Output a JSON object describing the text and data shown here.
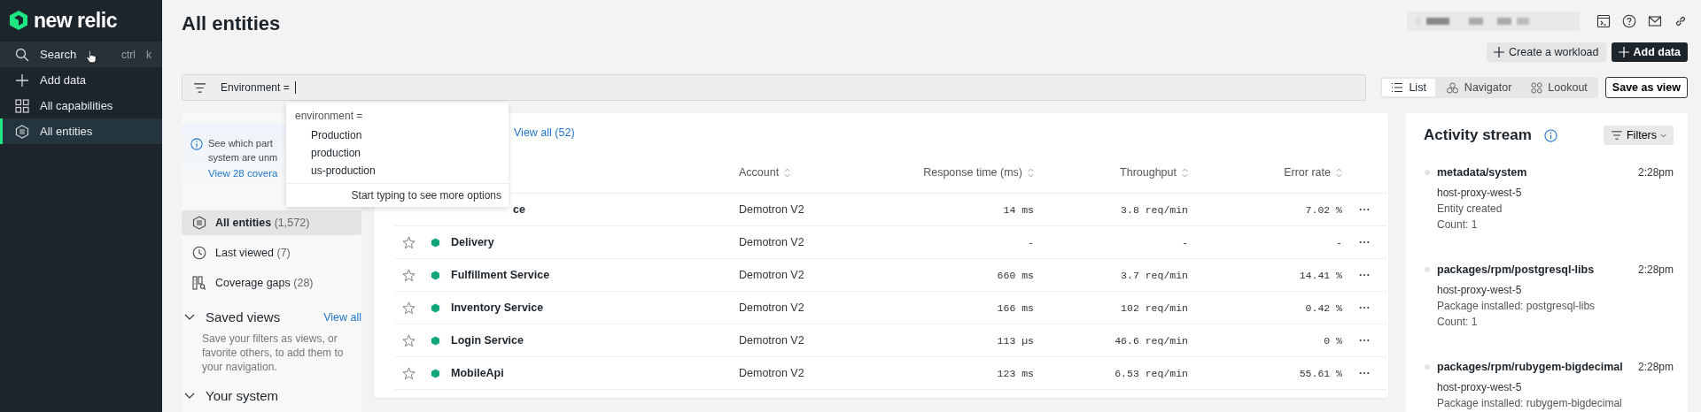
{
  "sidebar": {
    "logo": "new relic",
    "items": [
      {
        "label": "Search",
        "shortcut": [
          "ctrl",
          "k"
        ],
        "selected": false,
        "hovered": true
      },
      {
        "label": "Add data",
        "selected": false,
        "hovered": false
      },
      {
        "label": "All capabilities",
        "selected": false,
        "hovered": false
      },
      {
        "label": "All entities",
        "selected": true,
        "hovered": false
      }
    ]
  },
  "header": {
    "title": "All entities",
    "actions": [
      {
        "label": "Create a workload",
        "kind": "secondary"
      },
      {
        "label": "Add data",
        "kind": "primary"
      }
    ]
  },
  "filter": {
    "value": "Environment = "
  },
  "dropdown": {
    "heading": "environment =",
    "options": [
      "Production",
      "production",
      "us-production"
    ],
    "footer": "Start typing to see more options"
  },
  "views": {
    "tabs": [
      {
        "label": "List",
        "selected": true
      },
      {
        "label": "Navigator",
        "selected": false
      },
      {
        "label": "Lookout",
        "selected": false
      }
    ],
    "save": "Save as view"
  },
  "left_panel": {
    "notice": {
      "lines": [
        "See which part",
        "system are unm"
      ],
      "link": "View 28 covera"
    },
    "nav": [
      {
        "label": "All entities",
        "count": "(1,572)",
        "selected": true
      },
      {
        "label": "Last viewed",
        "count": "(7)",
        "selected": false
      },
      {
        "label": "Coverage gaps",
        "count": "(28)",
        "selected": false
      }
    ],
    "saved_views": {
      "title": "Saved views",
      "link": "View all",
      "description": "Save your filters as views, or favorite others, to add them to your navigation."
    },
    "your_system": {
      "title": "Your system"
    }
  },
  "table": {
    "view_all": "View all (52)",
    "columns": [
      "Account",
      "Response time (ms)",
      "Throughput",
      "Error rate"
    ],
    "rows": [
      {
        "kind": "covered",
        "name": "ce",
        "account": "Demotron V2",
        "response_time": "14 ms",
        "throughput": "3.8 req/min",
        "error_rate": "7.02 %"
      },
      {
        "kind": "entity",
        "name": "Delivery",
        "account": "Demotron V2",
        "response_time": "-",
        "throughput": "-",
        "error_rate": "-"
      },
      {
        "kind": "entity",
        "name": "Fulfillment Service",
        "account": "Demotron V2",
        "response_time": "660 ms",
        "throughput": "3.7 req/min",
        "error_rate": "14.41 %"
      },
      {
        "kind": "entity",
        "name": "Inventory Service",
        "account": "Demotron V2",
        "response_time": "166 ms",
        "throughput": "102 req/min",
        "error_rate": "0.42 %"
      },
      {
        "kind": "entity",
        "name": "Login Service",
        "account": "Demotron V2",
        "response_time": "113 µs",
        "throughput": "46.6 req/min",
        "error_rate": "0 %"
      },
      {
        "kind": "entity",
        "name": "MobileApi",
        "account": "Demotron V2",
        "response_time": "123 ms",
        "throughput": "6.53 req/min",
        "error_rate": "55.61 %"
      }
    ]
  },
  "activity_stream": {
    "title": "Activity stream",
    "filters": "Filters",
    "items": [
      {
        "title": "metadata/system",
        "time": "2:28pm",
        "lines": [
          "host-proxy-west-5",
          "Entity created",
          "Count: 1"
        ]
      },
      {
        "title": "packages/rpm/postgresql-libs",
        "time": "2:28pm",
        "lines": [
          "host-proxy-west-5",
          "Package installed: postgresql-libs",
          "Count: 1"
        ]
      },
      {
        "title": "packages/rpm/rubygem-bigdecimal",
        "time": "2:28pm",
        "lines": [
          "host-proxy-west-5",
          "Package installed: rubygem-bigdecimal"
        ]
      }
    ]
  }
}
